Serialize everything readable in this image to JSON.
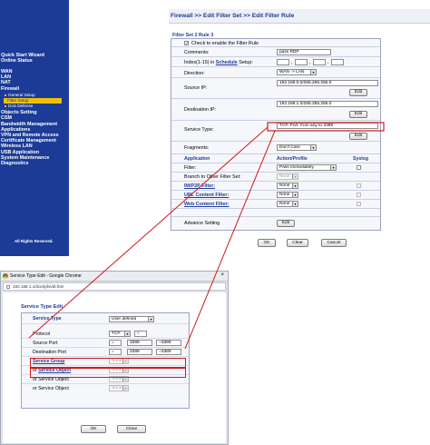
{
  "sidebar": {
    "items": [
      {
        "label": "Quick Start Wizard"
      },
      {
        "label": "Online Status"
      },
      {
        "label": "WAN"
      },
      {
        "label": "LAN"
      },
      {
        "label": "NAT"
      },
      {
        "label": "Firewall"
      },
      {
        "label": "Objects Setting"
      },
      {
        "label": "CSM"
      },
      {
        "label": "Bandwidth Management"
      },
      {
        "label": "Applications"
      },
      {
        "label": "VPN and Remote Access"
      },
      {
        "label": "Certificate Management"
      },
      {
        "label": "Wireless LAN"
      },
      {
        "label": "USB Application"
      },
      {
        "label": "System Maintenance"
      },
      {
        "label": "Diagnostics"
      }
    ],
    "subitems": [
      {
        "label": "General Setup"
      },
      {
        "label": "Filter Setup"
      },
      {
        "label": "DoS Defense"
      }
    ],
    "rights": "All Rights Reserved."
  },
  "page": {
    "title": "Firewall >> Edit Filter Set >> Edit Filter Rule",
    "section": "Filter Set 2 Rule 3"
  },
  "form": {
    "enable_label": "Check to enable the Filter Rule",
    "comments_label": "Comments:",
    "comments_value": "pass RDP",
    "index_label": "Index(1-15) in",
    "schedule_link": "Schedule",
    "setup_label": "Setup:",
    "schedule_sep": ",",
    "direction_label": "Direction:",
    "direction_value": "WAN -> LAN",
    "source_ip_label": "Source IP:",
    "source_ip_value": "192.168.0.0/255.255.255.0",
    "destination_ip_label": "Destination IP:",
    "destination_ip_value": "192.168.1.0/255.255.255.0",
    "service_type_label": "Service Type:",
    "service_type_value": "TCP, Port: from any to 3389",
    "fragments_label": "Fragments:",
    "fragments_value": "Don't Care",
    "edit_label": "Edit",
    "col_application": "Application",
    "col_action": "Action/Profile",
    "col_syslog": "Syslog",
    "filter_label": "Filter:",
    "filter_value": "Pass Immediately",
    "branch_label": "Branch to Other Filter Set:",
    "branch_value": "None",
    "im_p2p_label": "IM/P2P Filter:",
    "url_filter_label": "URL Content Filter:",
    "web_filter_label": "Web Content Filter:",
    "none_value": "None",
    "advance_label": "Advance Setting"
  },
  "buttons": {
    "ok": "OK",
    "clear": "Clear",
    "cancel": "Cancel"
  },
  "popup": {
    "window_title": "Service Type Edit - Google Chrome",
    "url": "192.168.1.1/doc/ipfsvdt.htm",
    "close_glyph": "×",
    "title": "Service Type Edit",
    "service_type_label": "Service Type",
    "service_type_value": "User defined",
    "protocol_label": "Protocol",
    "protocol_value": "TCP",
    "protocol_num": "6",
    "source_port_label": "Source Port",
    "destination_port_label": "Destination Port",
    "eq_symbol": "=",
    "port_from": "3389",
    "port_to_prefix": "~",
    "port_to": "3389",
    "service_group_label": "Service Group",
    "service_object_label": "Service Object",
    "or_label": "or",
    "none_value": "None",
    "ok": "OK",
    "close": "Close"
  },
  "colors": {
    "sidebar_bg": "#1b3b96",
    "active_item": "#f0c000",
    "highlight": "#d11a1a",
    "title_blue": "#1b3b96"
  }
}
